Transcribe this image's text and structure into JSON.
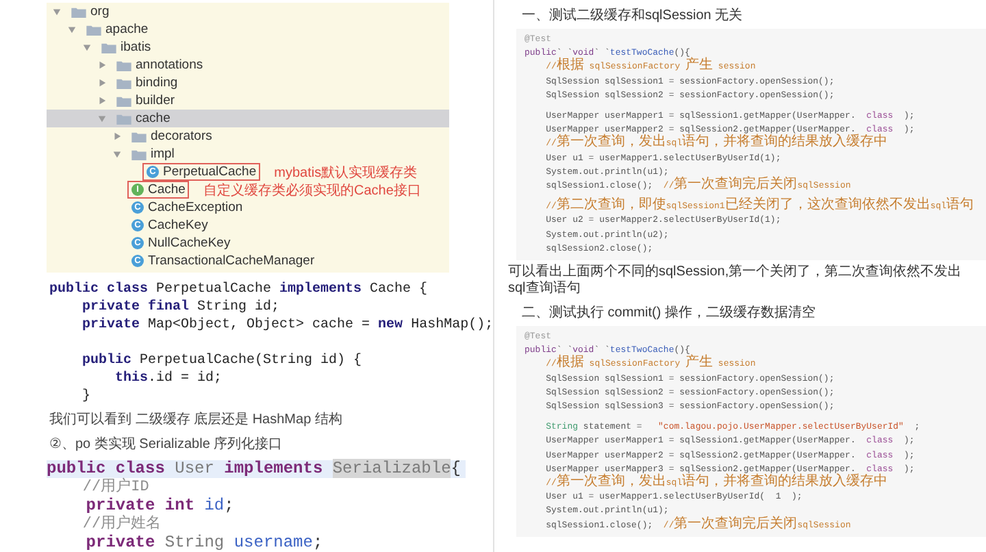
{
  "left": {
    "tree": [
      {
        "label": "org",
        "kind": "package",
        "expanded": true,
        "selected": false,
        "children": [
          {
            "label": "apache",
            "kind": "package",
            "expanded": true,
            "selected": false,
            "children": [
              {
                "label": "ibatis",
                "kind": "package",
                "expanded": true,
                "selected": false,
                "children": [
                  {
                    "label": "annotations",
                    "kind": "package",
                    "expanded": false,
                    "selected": false
                  },
                  {
                    "label": "binding",
                    "kind": "package",
                    "expanded": false,
                    "selected": false
                  },
                  {
                    "label": "builder",
                    "kind": "package",
                    "expanded": false,
                    "selected": false
                  },
                  {
                    "label": "cache",
                    "kind": "package",
                    "expanded": true,
                    "selected": true,
                    "children": [
                      {
                        "label": "decorators",
                        "kind": "package",
                        "expanded": false,
                        "selected": false
                      },
                      {
                        "label": "impl",
                        "kind": "package",
                        "expanded": true,
                        "selected": false,
                        "children": [
                          {
                            "label": "PerpetualCache",
                            "kind": "class",
                            "badge": "C",
                            "selected": false,
                            "note": "mybatis默认实现缓存类"
                          }
                        ]
                      },
                      {
                        "label": "Cache",
                        "kind": "interface",
                        "badge": "I",
                        "selected": false,
                        "note": "自定义缓存类必须实现的Cache接口"
                      },
                      {
                        "label": "CacheException",
                        "kind": "class",
                        "badge": "C",
                        "selected": false
                      },
                      {
                        "label": "CacheKey",
                        "kind": "class",
                        "badge": "C",
                        "selected": false
                      },
                      {
                        "label": "NullCacheKey",
                        "kind": "class",
                        "badge": "C",
                        "selected": false
                      },
                      {
                        "label": "TransactionalCacheManager",
                        "kind": "class",
                        "badge": "C",
                        "selected": false
                      }
                    ]
                  }
                ]
              }
            ]
          }
        ]
      }
    ],
    "code_1": [
      {
        "kind": "code",
        "segments": [
          {
            "text": "public class ",
            "kind": "keyword"
          },
          {
            "text": "PerpetualCache ",
            "kind": "plain"
          },
          {
            "text": "implements ",
            "kind": "keyword"
          },
          {
            "text": "Cache {",
            "kind": "plain"
          }
        ]
      },
      {
        "kind": "code",
        "segments": [
          {
            "text": "    private final ",
            "kind": "keyword"
          },
          {
            "text": "String id;",
            "kind": "plain"
          }
        ]
      },
      {
        "kind": "code",
        "segments": [
          {
            "text": "    private ",
            "kind": "keyword"
          },
          {
            "text": "Map<Object, Object> cache = ",
            "kind": "plain"
          },
          {
            "text": "new ",
            "kind": "keyword"
          },
          {
            "text": "HashMap();",
            "kind": "plain"
          }
        ]
      },
      {
        "kind": "blank"
      },
      {
        "kind": "code",
        "segments": [
          {
            "text": "    public ",
            "kind": "keyword"
          },
          {
            "text": "PerpetualCache(String id) {",
            "kind": "plain"
          }
        ]
      },
      {
        "kind": "code",
        "segments": [
          {
            "text": "        this",
            "kind": "keyword"
          },
          {
            "text": ".id = id;",
            "kind": "plain"
          }
        ]
      },
      {
        "kind": "code",
        "segments": [
          {
            "text": "    }",
            "kind": "plain"
          }
        ]
      }
    ],
    "paragraphs": [
      "我们可以看到 二级缓存 底层还是 HashMap 结构",
      "②、po 类实现 Serializable 序列化接口"
    ],
    "code_2": [
      {
        "kind": "code",
        "highlighted": true,
        "segments": [
          {
            "text": "public class ",
            "kind": "keyword"
          },
          {
            "text": "User ",
            "kind": "type"
          },
          {
            "text": "implements ",
            "kind": "keyword"
          },
          {
            "text": "Serializable",
            "kind": "selection"
          },
          {
            "text": "{",
            "kind": "plain"
          }
        ]
      },
      {
        "kind": "code",
        "highlighted": false,
        "segments": [
          {
            "text": "    //用户ID",
            "kind": "comment"
          }
        ]
      },
      {
        "kind": "code",
        "highlighted": false,
        "segments": [
          {
            "text": "    private int ",
            "kind": "keyword"
          },
          {
            "text": "id",
            "kind": "field"
          },
          {
            "text": ";",
            "kind": "plain"
          }
        ]
      },
      {
        "kind": "code",
        "highlighted": false,
        "segments": [
          {
            "text": "    //用户姓名",
            "kind": "comment"
          }
        ]
      },
      {
        "kind": "code",
        "highlighted": false,
        "segments": [
          {
            "text": "    private ",
            "kind": "keyword"
          },
          {
            "text": "String ",
            "kind": "type"
          },
          {
            "text": "username",
            "kind": "field"
          },
          {
            "text": ";",
            "kind": "plain"
          }
        ]
      }
    ]
  },
  "right": {
    "sections": [
      {
        "heading": "一、测试二级缓存和sqlSession 无关",
        "code": [
          {
            "kind": "code",
            "segments": [
              {
                "text": "@Test",
                "kind": "annotation"
              }
            ]
          },
          {
            "kind": "code",
            "segments": [
              {
                "text": "public",
                "kind": "keyword"
              },
              {
                "text": "` `",
                "kind": "plain"
              },
              {
                "text": "void",
                "kind": "keyword"
              },
              {
                "text": "` `",
                "kind": "plain"
              },
              {
                "text": "testTwoCache",
                "kind": "method"
              },
              {
                "text": "(){",
                "kind": "plain"
              }
            ]
          },
          {
            "kind": "code",
            "segments": [
              {
                "text": "    //根据 sqlSessionFactory 产生 session",
                "kind": "comment"
              }
            ]
          },
          {
            "kind": "code",
            "segments": [
              {
                "text": "    SqlSession sqlSession1 = sessionFactory.openSession();",
                "kind": "plain"
              }
            ]
          },
          {
            "kind": "code",
            "segments": [
              {
                "text": "    SqlSession sqlSession2 = sessionFactory.openSession();",
                "kind": "plain"
              }
            ]
          },
          {
            "kind": "blank"
          },
          {
            "kind": "code",
            "segments": [
              {
                "text": "    UserMapper userMapper1 = sqlSession1.getMapper(UserMapper.  ",
                "kind": "plain"
              },
              {
                "text": "class",
                "kind": "literal"
              },
              {
                "text": "  );",
                "kind": "plain"
              }
            ]
          },
          {
            "kind": "code",
            "segments": [
              {
                "text": "    UserMapper userMapper2 = sqlSession2.getMapper(UserMapper.  ",
                "kind": "plain"
              },
              {
                "text": "class",
                "kind": "literal"
              },
              {
                "text": "  );",
                "kind": "plain"
              }
            ]
          },
          {
            "kind": "code",
            "segments": [
              {
                "text": "    //第一次查询，发出sql语句，并将查询的结果放入缓存中",
                "kind": "comment"
              }
            ]
          },
          {
            "kind": "code",
            "segments": [
              {
                "text": "    User u1 = userMapper1.selectUserByUserId(1);",
                "kind": "plain"
              }
            ]
          },
          {
            "kind": "code",
            "segments": [
              {
                "text": "    System.out.println(u1);",
                "kind": "plain"
              }
            ]
          },
          {
            "kind": "code",
            "segments": [
              {
                "text": "    sqlSession1.close();  ",
                "kind": "plain"
              },
              {
                "text": "//第一次查询完后关闭sqlSession",
                "kind": "comment"
              }
            ]
          },
          {
            "kind": "blank"
          },
          {
            "kind": "code",
            "segments": [
              {
                "text": "    //第二次查询，即使sqlSession1已经关闭了，这次查询依然不发出sql语句",
                "kind": "comment"
              }
            ]
          },
          {
            "kind": "code",
            "segments": [
              {
                "text": "    User u2 = userMapper2.selectUserByUserId(1);",
                "kind": "plain"
              }
            ]
          },
          {
            "kind": "code",
            "segments": [
              {
                "text": "    System.out.println(u2);",
                "kind": "plain"
              }
            ]
          },
          {
            "kind": "code",
            "segments": [
              {
                "text": "    sqlSession2.close();",
                "kind": "plain"
              }
            ]
          }
        ],
        "after": "可以看出上面两个不同的sqlSession,第一个关闭了，第二次查询依然不发出sql查询语句"
      },
      {
        "heading": "二、测试执行 commit() 操作，二级缓存数据清空",
        "code": [
          {
            "kind": "code",
            "segments": [
              {
                "text": "@Test",
                "kind": "annotation"
              }
            ]
          },
          {
            "kind": "code",
            "segments": [
              {
                "text": "public",
                "kind": "keyword"
              },
              {
                "text": "` `",
                "kind": "plain"
              },
              {
                "text": "void",
                "kind": "keyword"
              },
              {
                "text": "` `",
                "kind": "plain"
              },
              {
                "text": "testTwoCache",
                "kind": "method"
              },
              {
                "text": "(){",
                "kind": "plain"
              }
            ]
          },
          {
            "kind": "code",
            "segments": [
              {
                "text": "    //根据 sqlSessionFactory 产生 session",
                "kind": "comment"
              }
            ]
          },
          {
            "kind": "code",
            "segments": [
              {
                "text": "    SqlSession sqlSession1 = sessionFactory.openSession();",
                "kind": "plain"
              }
            ]
          },
          {
            "kind": "code",
            "segments": [
              {
                "text": "    SqlSession sqlSession2 = sessionFactory.openSession();",
                "kind": "plain"
              }
            ]
          },
          {
            "kind": "code",
            "segments": [
              {
                "text": "    SqlSession sqlSession3 = sessionFactory.openSession();",
                "kind": "plain"
              }
            ]
          },
          {
            "kind": "blank"
          },
          {
            "kind": "code",
            "segments": [
              {
                "text": "    String",
                "kind": "type"
              },
              {
                "text": " statement =   ",
                "kind": "plain"
              },
              {
                "text": "\"com.lagou.pojo.UserMapper.selectUserByUserId\"",
                "kind": "string"
              },
              {
                "text": "  ;",
                "kind": "plain"
              }
            ]
          },
          {
            "kind": "code",
            "segments": [
              {
                "text": "    UserMapper userMapper1 = sqlSession1.getMapper(UserMapper.  ",
                "kind": "plain"
              },
              {
                "text": "class",
                "kind": "literal"
              },
              {
                "text": "  );",
                "kind": "plain"
              }
            ]
          },
          {
            "kind": "code",
            "segments": [
              {
                "text": "    UserMapper userMapper2 = sqlSession2.getMapper(UserMapper.  ",
                "kind": "plain"
              },
              {
                "text": "class",
                "kind": "literal"
              },
              {
                "text": "  );",
                "kind": "plain"
              }
            ]
          },
          {
            "kind": "code",
            "segments": [
              {
                "text": "    UserMapper userMapper3 = sqlSession2.getMapper(UserMapper.  ",
                "kind": "plain"
              },
              {
                "text": "class",
                "kind": "literal"
              },
              {
                "text": "  );",
                "kind": "plain"
              }
            ]
          },
          {
            "kind": "code",
            "segments": [
              {
                "text": "    //第一次查询，发出sql语句，并将查询的结果放入缓存中",
                "kind": "comment"
              }
            ]
          },
          {
            "kind": "code",
            "segments": [
              {
                "text": "    User u1 = userMapper1.selectUserByUserId(  1  );",
                "kind": "plain"
              }
            ]
          },
          {
            "kind": "code",
            "segments": [
              {
                "text": "    System.out.println(u1);",
                "kind": "plain"
              }
            ]
          },
          {
            "kind": "code",
            "segments": [
              {
                "text": "    sqlSession1.close();  ",
                "kind": "plain"
              },
              {
                "text": "//第一次查询完后关闭sqlSession",
                "kind": "comment"
              }
            ]
          }
        ]
      }
    ]
  }
}
